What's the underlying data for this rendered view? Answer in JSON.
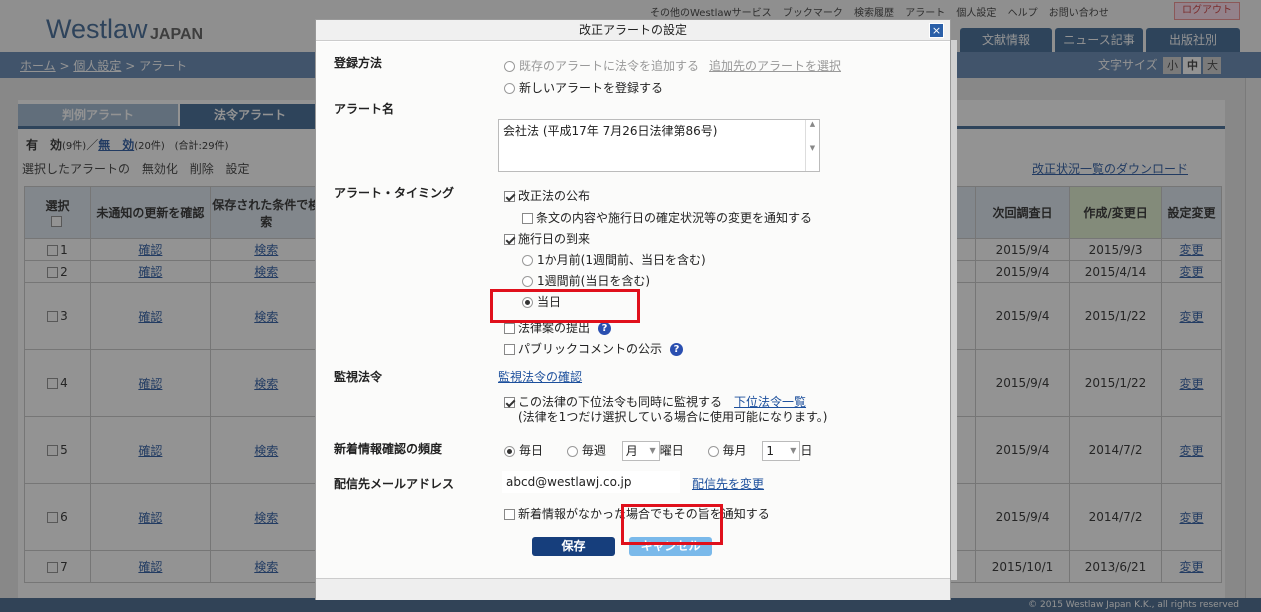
{
  "header": {
    "logo": "Westlaw",
    "logo_suffix": "JAPAN",
    "util_links": [
      "その他のWestlawサービス",
      "ブックマーク",
      "検索履歴",
      "アラート",
      "個人設定",
      "ヘルプ",
      "お問い合わせ"
    ],
    "logout": "ログアウト",
    "nav_tabs": [
      "文献情報",
      "ニュース記事",
      "出版社別"
    ]
  },
  "breadcrumb": {
    "home": "ホーム",
    "personal": "個人設定",
    "current": "アラート",
    "sep": ">"
  },
  "font_size": {
    "label": "文字サイズ",
    "options": [
      "小",
      "中",
      "大"
    ],
    "selected": "中"
  },
  "tabs": {
    "case": "判例アラート",
    "law": "法令アラート"
  },
  "summary": {
    "valid": "有　効",
    "valid_count": "(9件)",
    "slash": "／",
    "invalid": "無　効",
    "invalid_count": "(20件)",
    "total": "(合計:29件)"
  },
  "actions": {
    "prefix": "選択したアラートの",
    "disable": "無効化",
    "delete": "削除",
    "settings": "設定"
  },
  "download_link": "改正状況一覧のダウンロード",
  "table": {
    "headers": {
      "select": "選択",
      "check": "未通知の更新を確認",
      "search": "保存された条件で検索",
      "next": "次回調査日",
      "created": "作成/変更日",
      "change": "設定変更"
    },
    "rows": [
      {
        "no": "1",
        "check": "確認",
        "search": "検索",
        "next": "2015/9/4",
        "created": "2015/9/3",
        "change": "変更"
      },
      {
        "no": "2",
        "check": "確認",
        "search": "検索",
        "next": "2015/9/4",
        "created": "2015/4/14",
        "change": "変更"
      },
      {
        "no": "3",
        "check": "確認",
        "search": "検索",
        "next": "2015/9/4",
        "created": "2015/1/22",
        "change": "変更"
      },
      {
        "no": "4",
        "check": "確認",
        "search": "検索",
        "next": "2015/9/4",
        "created": "2015/1/22",
        "change": "変更"
      },
      {
        "no": "5",
        "check": "確認",
        "search": "検索",
        "next": "2015/9/4",
        "created": "2014/7/2",
        "change": "変更"
      },
      {
        "no": "6",
        "check": "確認",
        "search": "検索",
        "next": "2015/9/4",
        "created": "2014/7/2",
        "change": "変更"
      },
      {
        "no": "7",
        "check": "確認",
        "search": "検索",
        "next": "2015/10/1",
        "created": "2013/6/21",
        "change": "変更"
      }
    ]
  },
  "footer": "© 2015 Westlaw Japan K.K., all rights reserved",
  "modal": {
    "title": "改正アラートの設定",
    "close": "×",
    "reg_label": "登録方法",
    "reg_opt1": "既存のアラートに法令を追加する",
    "reg_opt1_link": "追加先のアラートを選択",
    "reg_opt2": "新しいアラートを登録する",
    "name_label": "アラート名",
    "name_value": "会社法 (平成17年 7月26日法律第86号)",
    "timing_label": "アラート・タイミング",
    "t_amend": "改正法の公布",
    "t_notify": "条文の内容や施行日の確定状況等の変更を通知する",
    "t_effective": "施行日の到来",
    "t_month": "1か月前(1週間前、当日を含む)",
    "t_week": "1週間前(当日を含む)",
    "t_day": "当日",
    "t_bill": "法律案の提出",
    "t_public": "パブリックコメントの公示",
    "monitor_label": "監視法令",
    "monitor_link": "監視法令の確認",
    "monitor_sub": "この法律の下位法令も同時に監視する",
    "monitor_sub_link": "下位法令一覧",
    "monitor_note": "(法律を1つだけ選択している場合に使用可能になります。)",
    "freq_label": "新着情報確認の頻度",
    "f_daily": "毎日",
    "f_weekly": "毎週",
    "f_weekday": "月",
    "f_weekday_suffix": "曜日",
    "f_monthly": "毎月",
    "f_monthday": "1",
    "f_monthday_suffix": "日",
    "email_label": "配信先メールアドレス",
    "email_value": "abcd@westlawj.co.jp",
    "email_change": "配信先を変更",
    "notify_none": "新着情報がなかった場合でもその旨を通知する",
    "save": "保存",
    "cancel": "キャンセル"
  }
}
